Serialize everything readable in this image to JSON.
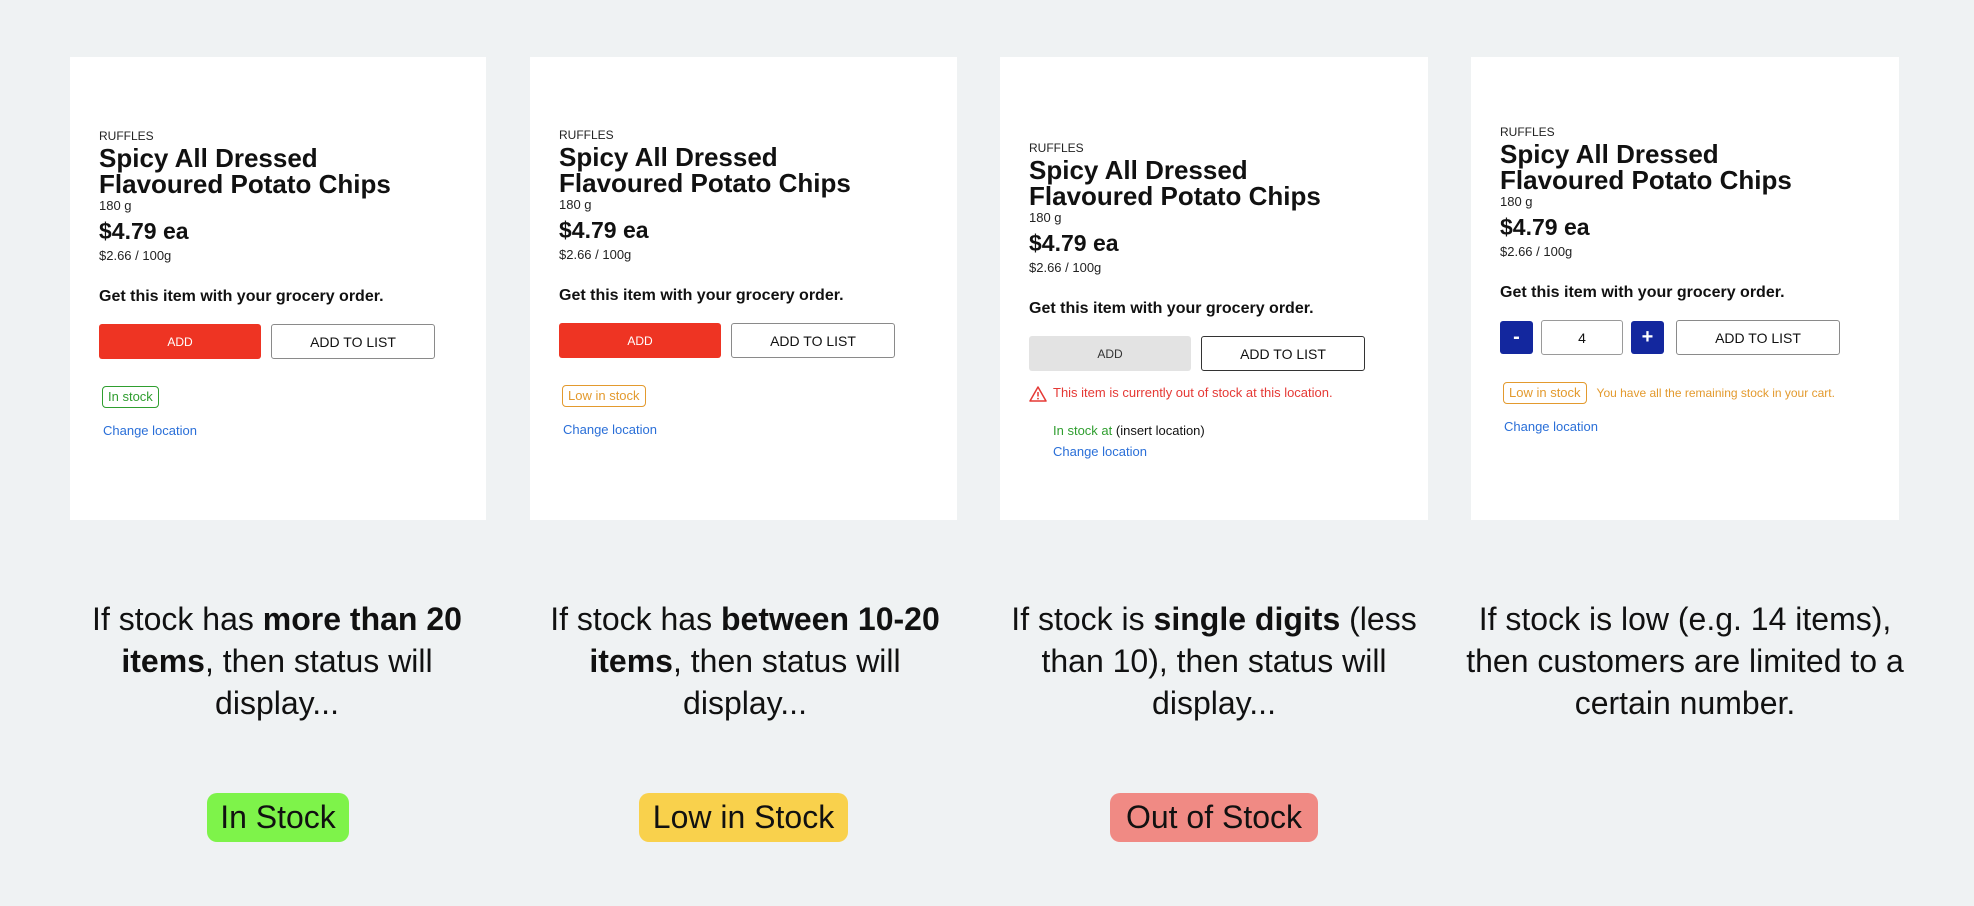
{
  "product": {
    "brand": "RUFFLES",
    "title_line1": "Spicy All Dressed",
    "title_line2": "Flavoured Potato Chips",
    "size": "180 g",
    "price": "$4.79 ea",
    "unit_price": "$2.66 / 100g",
    "promo": "Get this item with your grocery order.",
    "add_label": "ADD",
    "add_to_list_label": "ADD TO LIST",
    "change_location": "Change location"
  },
  "card1": {
    "badge": "In stock"
  },
  "card2": {
    "badge": "Low in stock"
  },
  "card3": {
    "warning": "This item is currently out of stock at this location.",
    "in_stock_at": "In stock at",
    "location": "(insert location)"
  },
  "card4": {
    "minus": "-",
    "quantity": "4",
    "plus": "+",
    "badge": "Low in stock",
    "note": "You have all the remaining stock in your cart."
  },
  "descriptions": {
    "d1_pre": "If stock has ",
    "d1_bold": "more than 20 items",
    "d1_post": ", then status will display...",
    "d2_pre": "If stock has ",
    "d2_bold": "between 10-20 items",
    "d2_post": ", then status will display...",
    "d3_pre": "If stock is ",
    "d3_bold": "single digits",
    "d3_post": " (less than 10), then status will display...",
    "d4": "If stock is low (e.g. 14 items), then customers are limited to a certain number."
  },
  "pills": {
    "in_stock": "In Stock",
    "low_in_stock": "Low in Stock",
    "out_of_stock": "Out of Stock"
  },
  "colors": {
    "in_stock_pill": "#7ef34a",
    "low_stock_pill": "#f9d14c",
    "out_of_stock_pill": "#f08a84",
    "add_button": "#ee3423",
    "stepper": "#13279e",
    "link": "#2a6fd8"
  }
}
